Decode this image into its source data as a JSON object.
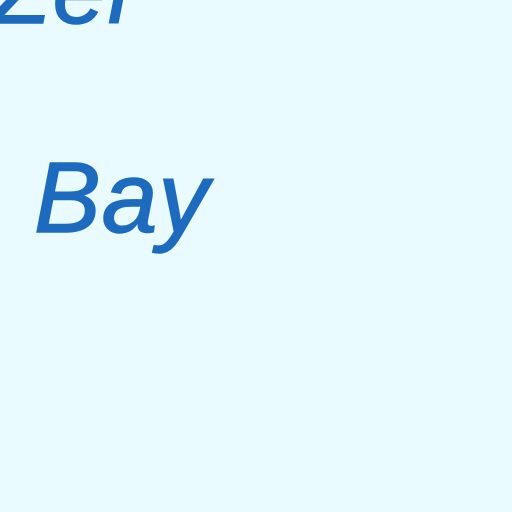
{
  "map": {
    "background_color": "#e9fbfe",
    "label_color": "#1d6bbf",
    "labels": {
      "top_partial": "Zel",
      "bay": "Bay"
    }
  }
}
